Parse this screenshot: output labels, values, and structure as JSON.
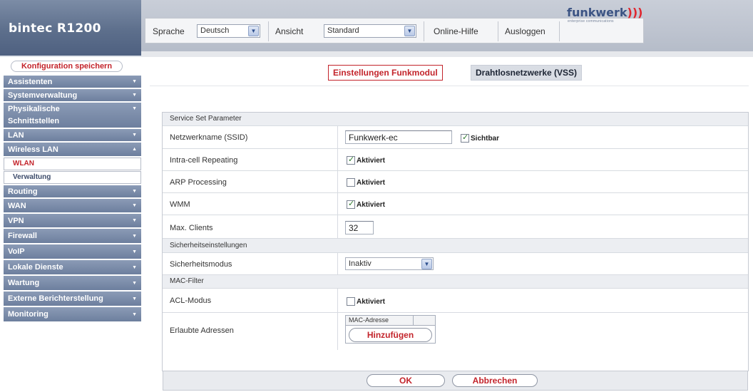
{
  "app": {
    "title": "bintec R1200"
  },
  "toolbar": {
    "language_label": "Sprache",
    "language_value": "Deutsch",
    "view_label": "Ansicht",
    "view_value": "Standard",
    "help_label": "Online-Hilfe",
    "logout_label": "Ausloggen",
    "logo_text": "funkwerk",
    "logo_subtext": "enterprise communications"
  },
  "sidebar": {
    "save_label": "Konfiguration speichern",
    "items": [
      {
        "label": "Assistenten",
        "arrow": "down"
      },
      {
        "label": "Systemverwaltung",
        "arrow": "down"
      },
      {
        "label": "Physikalische Schnittstellen",
        "line1": "Physikalische",
        "line2": "Schnittstellen",
        "arrow": "down"
      },
      {
        "label": "LAN",
        "arrow": "down"
      },
      {
        "label": "Wireless LAN",
        "arrow": "up"
      },
      {
        "label": "Routing",
        "arrow": "down"
      },
      {
        "label": "WAN",
        "arrow": "down"
      },
      {
        "label": "VPN",
        "arrow": "down"
      },
      {
        "label": "Firewall",
        "arrow": "down"
      },
      {
        "label": "VoIP",
        "arrow": "down"
      },
      {
        "label": "Lokale Dienste",
        "arrow": "down"
      },
      {
        "label": "Wartung",
        "arrow": "down"
      },
      {
        "label": "Externe Berichterstellung",
        "arrow": "down"
      },
      {
        "label": "Monitoring",
        "arrow": "down"
      }
    ],
    "subitems": [
      {
        "label": "WLAN",
        "active": true
      },
      {
        "label": "Verwaltung",
        "active": false
      }
    ]
  },
  "tabs": [
    {
      "label": "Einstellungen Funkmodul",
      "active": true
    },
    {
      "label": "Drahtlosnetzwerke (VSS)",
      "active": false
    }
  ],
  "form": {
    "sections": {
      "service": "Service Set Parameter",
      "security": "Sicherheitseinstellungen",
      "mac": "MAC-Filter"
    },
    "ssid": {
      "label": "Netzwerkname (SSID)",
      "value": "Funkwerk-ec",
      "visible_label": "Sichtbar",
      "visible": true
    },
    "intra_cell": {
      "label": "Intra-cell Repeating",
      "checkbox_label": "Aktiviert",
      "checked": true
    },
    "arp": {
      "label": "ARP Processing",
      "checkbox_label": "Aktiviert",
      "checked": false
    },
    "wmm": {
      "label": "WMM",
      "checkbox_label": "Aktiviert",
      "checked": true
    },
    "max_clients": {
      "label": "Max. Clients",
      "value": "32"
    },
    "security_mode": {
      "label": "Sicherheitsmodus",
      "value": "Inaktiv"
    },
    "acl_mode": {
      "label": "ACL-Modus",
      "checkbox_label": "Aktiviert",
      "checked": false
    },
    "allowed": {
      "label": "Erlaubte Adressen",
      "column_header": "MAC-Adresse",
      "add_label": "Hinzufügen"
    }
  },
  "footer": {
    "ok_label": "OK",
    "cancel_label": "Abbrechen"
  },
  "colors": {
    "accent": "#c3242b",
    "nav": "#6d7f9e",
    "brand": "#5d6f8c"
  }
}
